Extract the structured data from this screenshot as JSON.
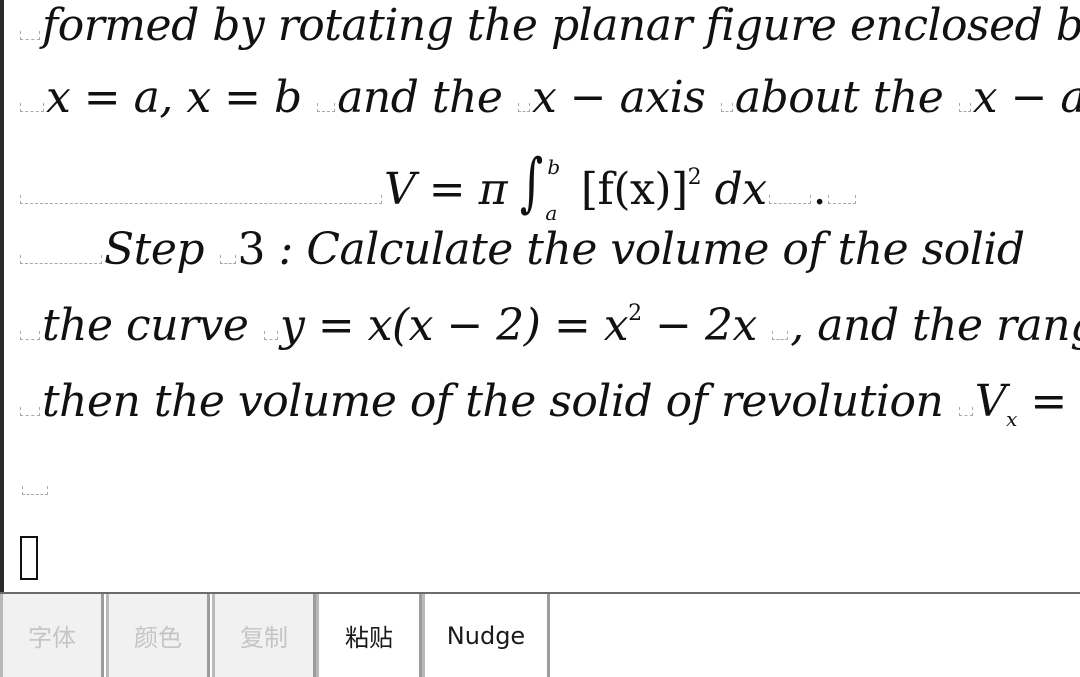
{
  "document": {
    "line1": "formed by rotating the planar figure enclosed b",
    "line2_a": "x = a",
    "line2_b": ", x = b",
    "line2_c": "and the",
    "line2_d": "x − axis",
    "line2_e": "about the",
    "line2_f": "x − axis",
    "formula_lhs": "V = π",
    "formula_lower": "a",
    "formula_upper": "b",
    "formula_body": "[f(x)]",
    "formula_exp": "2",
    "formula_dx": "dx",
    "formula_end": ".",
    "line4_a": "Step",
    "line4_b": "3",
    "line4_c": ": Calculate the volume of the solid",
    "line5_a": "the curve",
    "line5_b": "y = x(x − 2) = x",
    "line5_exp": "2",
    "line5_c": " − 2x",
    "line5_d": ", and the range",
    "line6_a": "then the volume of the solid of revolution",
    "line6_b": "V",
    "line6_sub": "x",
    "line6_c": " ="
  },
  "toolbar": {
    "buttons": [
      {
        "label": "字体",
        "enabled": false
      },
      {
        "label": "颜色",
        "enabled": false
      },
      {
        "label": "复制",
        "enabled": false
      },
      {
        "label": "粘贴",
        "enabled": true
      },
      {
        "label": "Nudge",
        "enabled": true
      }
    ]
  }
}
